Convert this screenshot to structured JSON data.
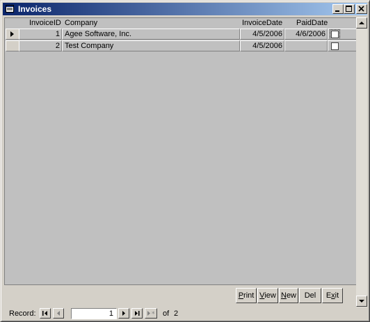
{
  "window": {
    "title": "Invoices"
  },
  "columns": {
    "invoice_id": "InvoiceID",
    "company": "Company",
    "invoice_date": "InvoiceDate",
    "paid_date": "PaidDate"
  },
  "rows": [
    {
      "invoice_id": "1",
      "company": "Agee Software, Inc.",
      "invoice_date": "4/5/2006",
      "paid_date": "4/6/2006",
      "paid": false
    },
    {
      "invoice_id": "2",
      "company": "Test Company",
      "invoice_date": "4/5/2006",
      "paid_date": "",
      "paid": false
    }
  ],
  "buttons": {
    "print": {
      "pre": "",
      "key": "P",
      "post": "rint"
    },
    "view": {
      "pre": "",
      "key": "V",
      "post": "iew"
    },
    "new": {
      "pre": "",
      "key": "N",
      "post": "ew"
    },
    "del": {
      "pre": "Del",
      "key": "",
      "post": ""
    },
    "exit": {
      "pre": "E",
      "key": "x",
      "post": "it"
    }
  },
  "navigator": {
    "label": "Record:",
    "current": "1",
    "of_label": "of",
    "total": "2"
  },
  "icons": [
    "form-icon",
    "minimize-icon",
    "maximize-icon",
    "close-icon",
    "record-selector-arrow-icon",
    "first-record-icon",
    "prev-record-icon",
    "next-record-icon",
    "last-record-icon",
    "new-record-icon",
    "scroll-up-icon",
    "scroll-down-icon"
  ]
}
